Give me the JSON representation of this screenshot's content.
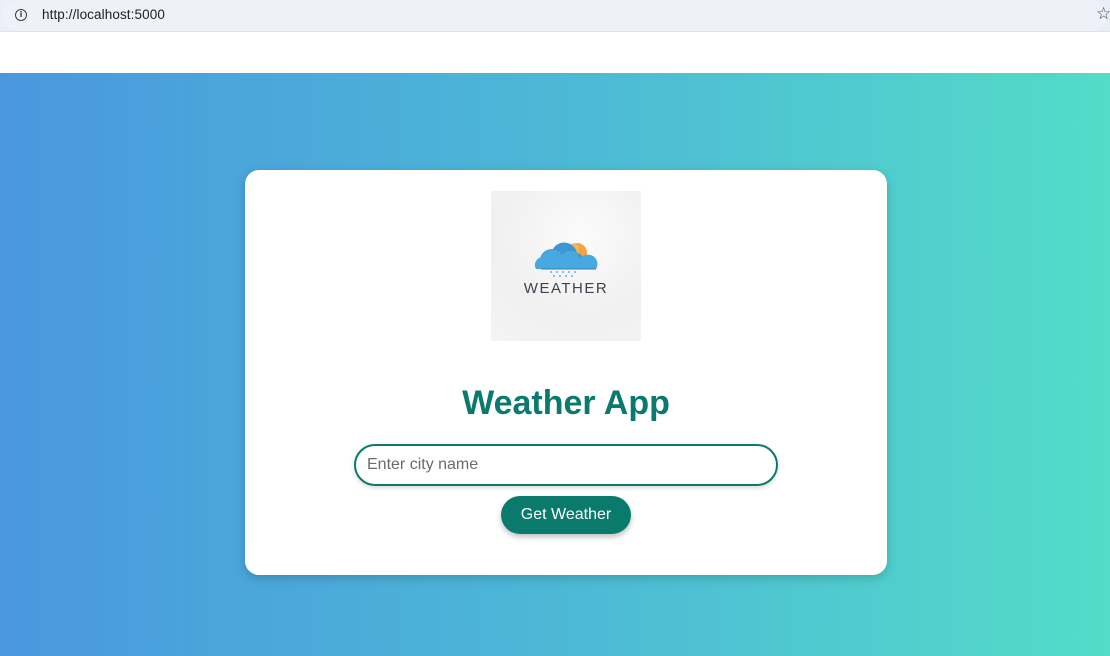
{
  "browser": {
    "url": "http://localhost:5000",
    "info_icon_glyph": "i",
    "star_icon_glyph": "☆"
  },
  "logo": {
    "word": "WEATHER",
    "icon": "cloud-sun-rain-icon"
  },
  "app": {
    "title": "Weather App",
    "city_input": {
      "value": "",
      "placeholder": "Enter city name"
    },
    "submit_label": "Get Weather"
  },
  "colors": {
    "accent": "#097a6c",
    "gradient_start": "#4a97de",
    "gradient_end": "#53dcc8"
  }
}
